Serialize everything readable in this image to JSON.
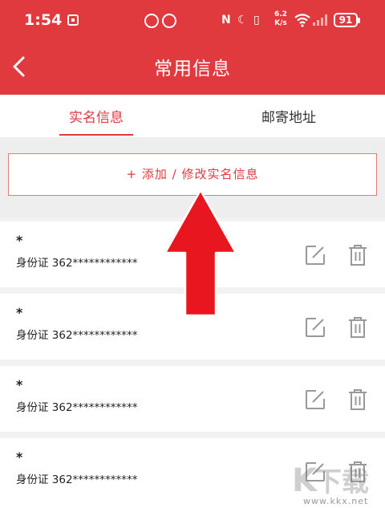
{
  "status_bar": {
    "time": "1:54",
    "network_speed_value": "6.2",
    "network_speed_unit": "K/s",
    "battery": "91",
    "nfc": "N"
  },
  "header": {
    "title": "常用信息"
  },
  "tabs": [
    {
      "label": "实名信息",
      "active": true
    },
    {
      "label": "邮寄地址",
      "active": false
    }
  ],
  "add_button": {
    "label": "+ 添加 / 修改实名信息"
  },
  "records": [
    {
      "name": "*",
      "id_text": "身份证 362************"
    },
    {
      "name": "*",
      "id_text": "身份证 362************"
    },
    {
      "name": "*",
      "id_text": "身份证 362************"
    },
    {
      "name": "*",
      "id_text": "身份证 362************"
    }
  ],
  "watermark": {
    "site": "www.kkx.net"
  },
  "colors": {
    "accent": "#e03a3e",
    "arrow": "#e8161e"
  }
}
